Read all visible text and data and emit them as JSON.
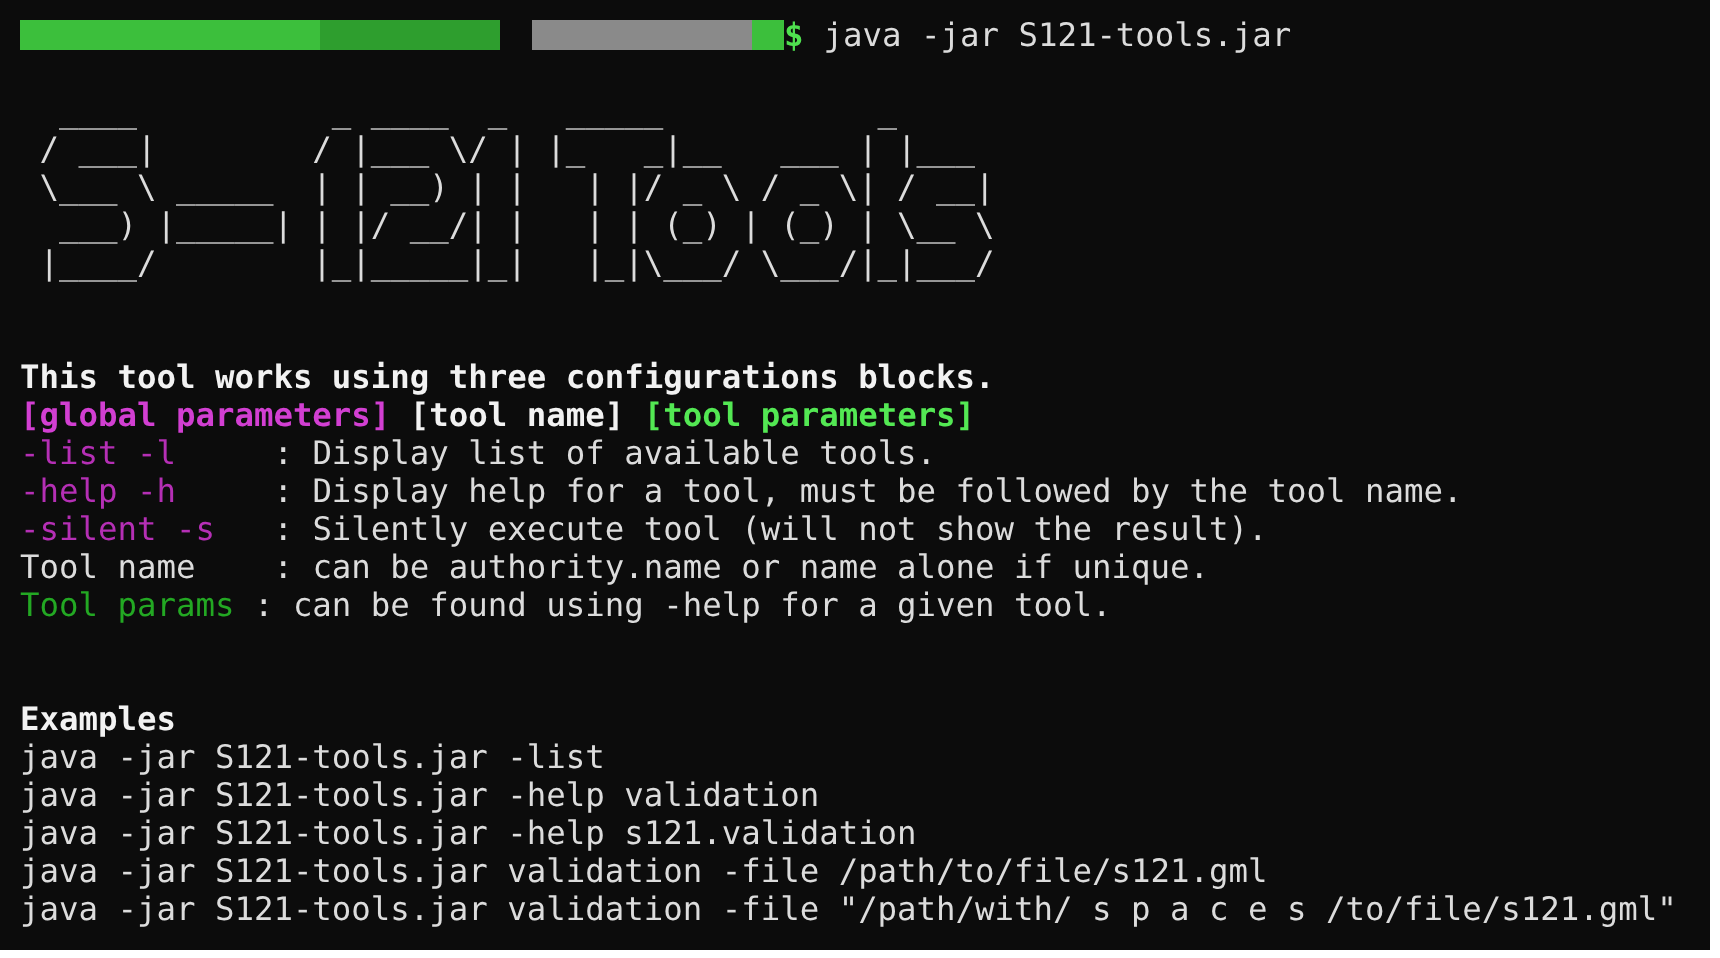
{
  "prompt": {
    "symbol": "$",
    "command": "java -jar S121-tools.jar"
  },
  "banner": [
    "  ____          _ ____  _   _____           _     ",
    " / ___|        / |___ \\/ | |_   _|__   ___ | |___ ",
    " \\___ \\ _____  | | __) | |   | |/ _ \\ / _ \\| / __|",
    "  ___) |_____| | |/ __/| |   | | (_) | (_) | \\__ \\",
    " |____/        |_|_____|_|   |_|\\___/ \\___/|_|___/"
  ],
  "help": [
    [
      {
        "kind": "bold",
        "text": "This tool works using three configurations blocks."
      }
    ],
    [
      {
        "kind": "option_header",
        "text": "[global parameters]"
      },
      {
        "kind": "bold",
        "text": " [tool name] "
      },
      {
        "kind": "param_header",
        "text": "[tool parameters]"
      }
    ],
    [
      {
        "kind": "option",
        "text": "-list -l    "
      },
      {
        "kind": "plain",
        "text": " : Display list of available tools."
      }
    ],
    [
      {
        "kind": "option",
        "text": "-help -h    "
      },
      {
        "kind": "plain",
        "text": " : Display help for a tool, must be followed by the tool name."
      }
    ],
    [
      {
        "kind": "option",
        "text": "-silent -s  "
      },
      {
        "kind": "plain",
        "text": " : Silently execute tool (will not show the result)."
      }
    ],
    [
      {
        "kind": "plain",
        "text": "Tool name   "
      },
      {
        "kind": "plain",
        "text": " : can be authority.name or name alone if unique."
      }
    ],
    [
      {
        "kind": "param",
        "text": "Tool params"
      },
      {
        "kind": "plain",
        "text": " : can be found using -help for a given tool."
      }
    ]
  ],
  "examples": {
    "title": "Examples",
    "lines": [
      "java -jar S121-tools.jar -list",
      "java -jar S121-tools.jar -help validation",
      "java -jar S121-tools.jar -help s121.validation",
      "java -jar S121-tools.jar validation -file /path/to/file/s121.gml",
      "java -jar S121-tools.jar validation -file \"/path/with/ s p a c e s /to/file/s121.gml\""
    ]
  }
}
